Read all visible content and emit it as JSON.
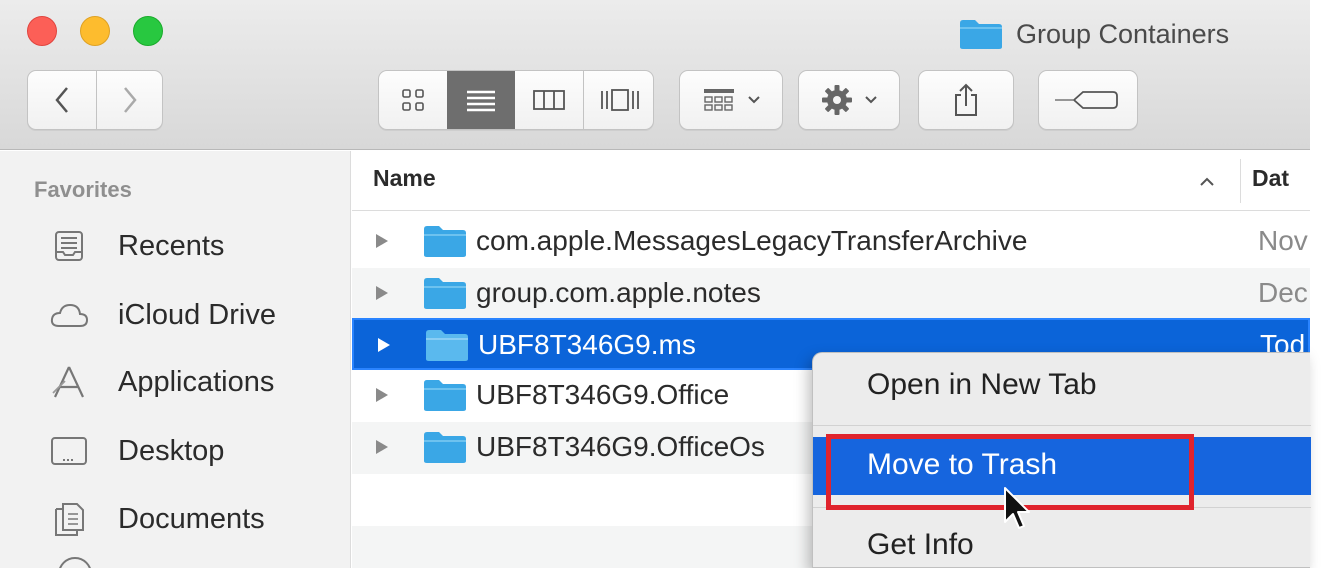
{
  "window": {
    "title": "Group Containers",
    "traffic_lights": {
      "close": "#fc5f57",
      "minimize": "#fdbc2e",
      "zoom": "#28c840"
    }
  },
  "toolbar": {
    "nav": [
      "back",
      "forward"
    ],
    "view_modes": [
      "icon-view",
      "list-view",
      "column-view",
      "cover-flow-view"
    ],
    "active_view": "list-view",
    "buttons": [
      "group-by",
      "action",
      "share",
      "tags"
    ]
  },
  "sidebar": {
    "heading": "Favorites",
    "items": [
      {
        "label": "Recents",
        "icon": "recents-icon"
      },
      {
        "label": "iCloud Drive",
        "icon": "icloud-icon"
      },
      {
        "label": "Applications",
        "icon": "applications-icon"
      },
      {
        "label": "Desktop",
        "icon": "desktop-icon"
      },
      {
        "label": "Documents",
        "icon": "documents-icon"
      }
    ]
  },
  "list": {
    "columns": {
      "name": "Name",
      "date": "Dat"
    },
    "rows": [
      {
        "name": "com.apple.MessagesLegacyTransferArchive",
        "date": "Nov"
      },
      {
        "name": "group.com.apple.notes",
        "date": "Dec"
      },
      {
        "name": "UBF8T346G9.ms",
        "date": "Tod",
        "selected": true
      },
      {
        "name": "UBF8T346G9.Office",
        "date": ""
      },
      {
        "name": "UBF8T346G9.OfficeOs",
        "date": ""
      }
    ]
  },
  "context_menu": {
    "items": [
      {
        "label": "Open in New Tab"
      },
      {
        "label": "Move to Trash",
        "highlighted": true
      },
      {
        "label": "Get Info"
      }
    ]
  },
  "colors": {
    "selection": "#0b64d9",
    "menu_highlight": "#1665de",
    "annotation": "#e0242d",
    "folder": "#3aa7e6"
  }
}
